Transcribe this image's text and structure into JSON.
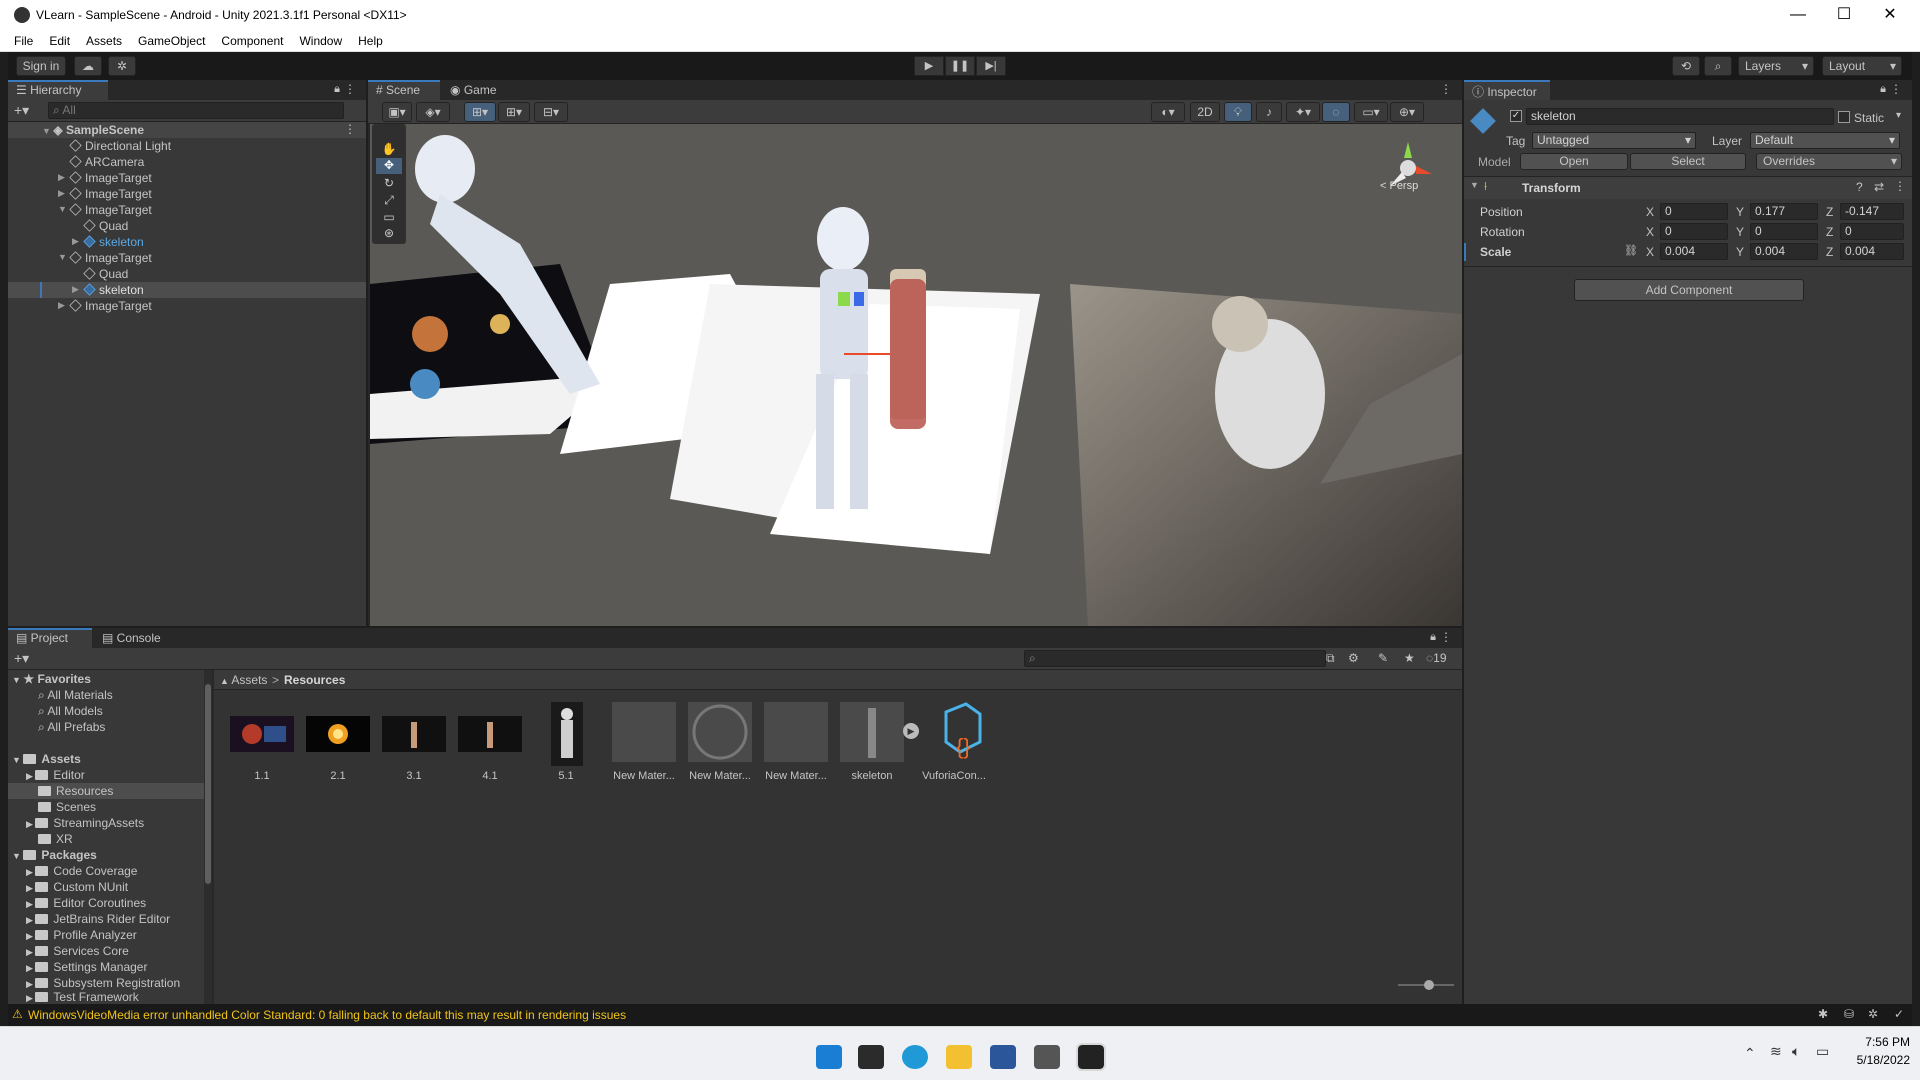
{
  "window": {
    "title": "VLearn - SampleScene - Android - Unity 2021.3.1f1 Personal <DX11>",
    "minimize": "—",
    "maximize": "☐",
    "close": "✕"
  },
  "menu": [
    "File",
    "Edit",
    "Assets",
    "GameObject",
    "Component",
    "Window",
    "Help"
  ],
  "toolbar": {
    "sign_in": "Sign in",
    "layers": "Layers",
    "layout": "Layout",
    "play": "▶",
    "pause": "❚❚",
    "step": "▶|"
  },
  "hierarchy": {
    "tab": "Hierarchy",
    "search_placeholder": "All",
    "scene": "SampleScene",
    "items": [
      {
        "label": "Directional Light"
      },
      {
        "label": "ARCamera"
      },
      {
        "label": "ImageTarget"
      },
      {
        "label": "ImageTarget"
      },
      {
        "label": "ImageTarget"
      },
      {
        "label": "Quad"
      },
      {
        "label": "skeleton"
      },
      {
        "label": "ImageTarget"
      },
      {
        "label": "Quad"
      },
      {
        "label": "skeleton"
      },
      {
        "label": "ImageTarget"
      }
    ]
  },
  "scene": {
    "tabs": [
      "Scene",
      "Game"
    ],
    "btn_2d": "2D",
    "persp": "< Persp"
  },
  "inspector": {
    "tab": "Inspector",
    "object_name": "skeleton",
    "static": "Static",
    "tag_label": "Tag",
    "tag_value": "Untagged",
    "layer_label": "Layer",
    "layer_value": "Default",
    "model_label": "Model",
    "open": "Open",
    "select": "Select",
    "overrides": "Overrides",
    "transform": "Transform",
    "position_label": "Position",
    "rotation_label": "Rotation",
    "scale_label": "Scale",
    "x": "X",
    "y": "Y",
    "z": "Z",
    "position": {
      "x": "0",
      "y": "0.177",
      "z": "-0.147"
    },
    "rotation": {
      "x": "0",
      "y": "0",
      "z": "0"
    },
    "scale": {
      "x": "0.004",
      "y": "0.004",
      "z": "0.004"
    },
    "add_component": "Add Component"
  },
  "project": {
    "tabs": [
      "Project",
      "Console"
    ],
    "favorites": "Favorites",
    "favorite_items": [
      "All Materials",
      "All Models",
      "All Prefabs"
    ],
    "assets": "Assets",
    "asset_folders": [
      "Editor",
      "Resources",
      "Scenes",
      "StreamingAssets",
      "XR"
    ],
    "packages": "Packages",
    "package_folders": [
      "Code Coverage",
      "Custom NUnit",
      "Editor Coroutines",
      "JetBrains Rider Editor",
      "Profile Analyzer",
      "Services Core",
      "Settings Manager",
      "Subsystem Registration",
      "Test Framework"
    ],
    "breadcrumb_root": "Assets",
    "breadcrumb_sep": ">",
    "breadcrumb_current": "Resources",
    "hidden_count": "19",
    "thumbnails": [
      "1.1",
      "2.1",
      "3.1",
      "4.1",
      "5.1",
      "New Mater...",
      "New Mater...",
      "New Mater...",
      "skeleton",
      "VuforiaCon..."
    ]
  },
  "status": {
    "message": "WindowsVideoMedia error unhandled Color Standard: 0  falling back to default this may result in rendering issues"
  },
  "taskbar": {
    "time": "7:56 PM",
    "date": "5/18/2022"
  },
  "colors": {
    "accent": "#3a79bb",
    "selection": "#2c5d87",
    "warning": "#f0c419"
  }
}
